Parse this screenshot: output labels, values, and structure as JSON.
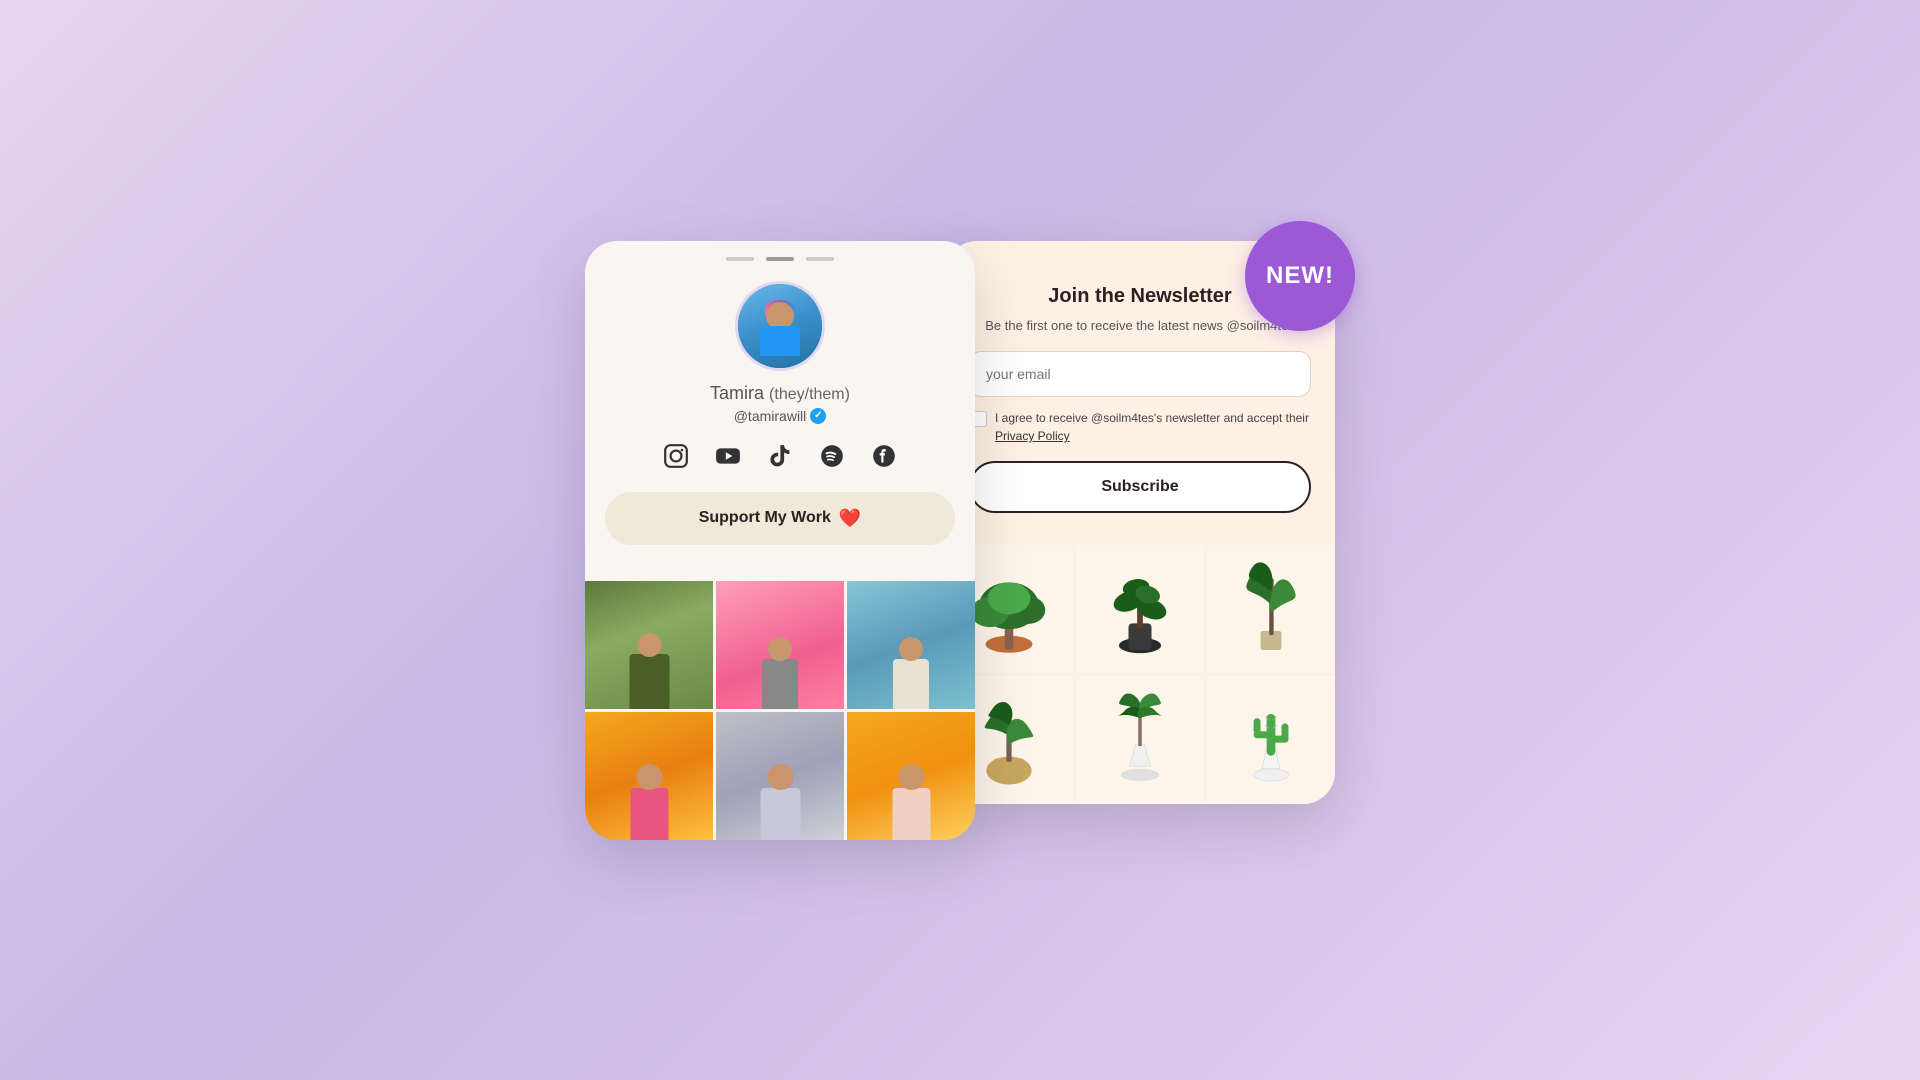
{
  "left_card": {
    "dots": [
      "inactive",
      "active",
      "inactive"
    ],
    "profile": {
      "name": "Tamira",
      "pronouns": "(they/them)",
      "handle": "@tamirawill",
      "verified": true
    },
    "social_links": [
      {
        "name": "Instagram",
        "icon": "instagram"
      },
      {
        "name": "YouTube",
        "icon": "youtube"
      },
      {
        "name": "TikTok",
        "icon": "tiktok"
      },
      {
        "name": "Spotify",
        "icon": "spotify"
      },
      {
        "name": "Facebook",
        "icon": "facebook"
      }
    ],
    "support_button": {
      "label": "Support My Work",
      "emoji": "❤️"
    },
    "photos": [
      {
        "id": 1,
        "style": "olive-outfit"
      },
      {
        "id": 2,
        "style": "pink-background"
      },
      {
        "id": 3,
        "style": "blue-background"
      },
      {
        "id": 4,
        "style": "yellow-background"
      },
      {
        "id": 5,
        "style": "silver-outfit"
      },
      {
        "id": 6,
        "style": "orange-background"
      }
    ]
  },
  "right_card": {
    "new_badge_label": "NEW!",
    "newsletter": {
      "title": "Join the Newsletter",
      "description": "Be the first one to receive the latest news @soilm4tes",
      "email_placeholder": "your email",
      "checkbox_text": "I agree to receive @soilm4tes's newsletter and accept their",
      "privacy_link_text": "Privacy Policy",
      "subscribe_button_label": "Subscribe"
    },
    "plants": [
      {
        "id": 1,
        "type": "bonsai",
        "pot_color": "#c4703a"
      },
      {
        "id": 2,
        "type": "rubber-plant",
        "pot_color": "#3a3a3a"
      },
      {
        "id": 3,
        "type": "tall-leaf",
        "pot_color": "#c8b890"
      },
      {
        "id": 4,
        "type": "fiddle-leaf",
        "pot_color": "#c8b060"
      },
      {
        "id": 5,
        "type": "dracaena",
        "pot_color": "#ffffff"
      },
      {
        "id": 6,
        "type": "cactus",
        "pot_color": "#ffffff"
      }
    ]
  }
}
